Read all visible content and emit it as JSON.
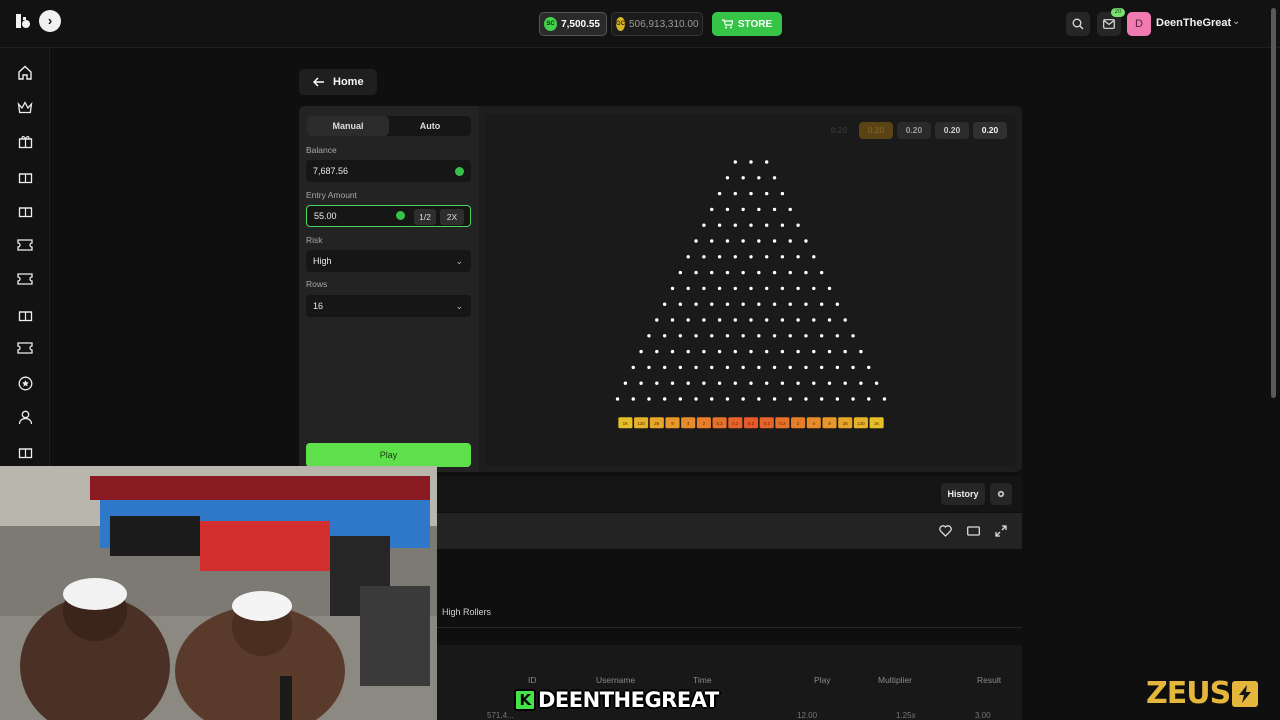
{
  "topbar": {
    "sweeps_coins": "7,500.55",
    "sc_symbol": "SC",
    "gold_coins": "506,913,310.00",
    "gc_symbol": "GC",
    "store_label": "STORE",
    "notification_count": "20",
    "avatar_initial": "D",
    "username": "DeenTheGreat"
  },
  "sidebar": {
    "icons": [
      "home-icon",
      "crown-icon",
      "gift-box-icon",
      "gift-icon",
      "gift-icon",
      "ticket-icon",
      "ticket-icon",
      "gift-icon",
      "ticket-icon",
      "badge-icon",
      "user-icon",
      "gift-icon"
    ]
  },
  "nav": {
    "home_label": "Home"
  },
  "controls": {
    "tabs": [
      "Manual",
      "Auto"
    ],
    "active_tab": "Manual",
    "balance_label": "Balance",
    "balance_value": "7,687.56",
    "entry_label": "Entry Amount",
    "entry_value": "55.00",
    "half_label": "1/2",
    "double_label": "2X",
    "risk_label": "Risk",
    "risk_value": "High",
    "rows_label": "Rows",
    "rows_value": "16",
    "play_label": "Play"
  },
  "board": {
    "recent_results": [
      "0.20",
      "0.20",
      "0.20",
      "0.20",
      "0.20"
    ],
    "peg_rows": 16,
    "buckets": [
      {
        "label": "1K",
        "color": "#e6c02a"
      },
      {
        "label": "130",
        "color": "#e6b22a"
      },
      {
        "label": "26",
        "color": "#e6a62a"
      },
      {
        "label": "9",
        "color": "#e6992a"
      },
      {
        "label": "4",
        "color": "#e68c2a"
      },
      {
        "label": "2",
        "color": "#e67e2a"
      },
      {
        "label": "0.2",
        "color": "#e6712a"
      },
      {
        "label": "0.2",
        "color": "#e6642a"
      },
      {
        "label": "0.2",
        "color": "#e65a2a"
      },
      {
        "label": "0.2",
        "color": "#e6642a"
      },
      {
        "label": "0.2",
        "color": "#e6712a"
      },
      {
        "label": "2",
        "color": "#e67e2a"
      },
      {
        "label": "4",
        "color": "#e68c2a"
      },
      {
        "label": "9",
        "color": "#e6992a"
      },
      {
        "label": "26",
        "color": "#e6a62a"
      },
      {
        "label": "130",
        "color": "#e6b22a"
      },
      {
        "label": "1K",
        "color": "#e6c02a"
      }
    ]
  },
  "panel": {
    "history_label": "History",
    "high_rollers_label": "High Rollers",
    "table_headers": [
      "ID",
      "Username",
      "Time",
      "Play",
      "Multiplier",
      "Result"
    ],
    "table_row": [
      "571,4...",
      "",
      "",
      "12.00",
      "1.25x",
      "3.00"
    ]
  },
  "stream": {
    "streamer_name": "DEENTHEGREAT",
    "badge_letter": "K",
    "brand": "ZEUS"
  }
}
